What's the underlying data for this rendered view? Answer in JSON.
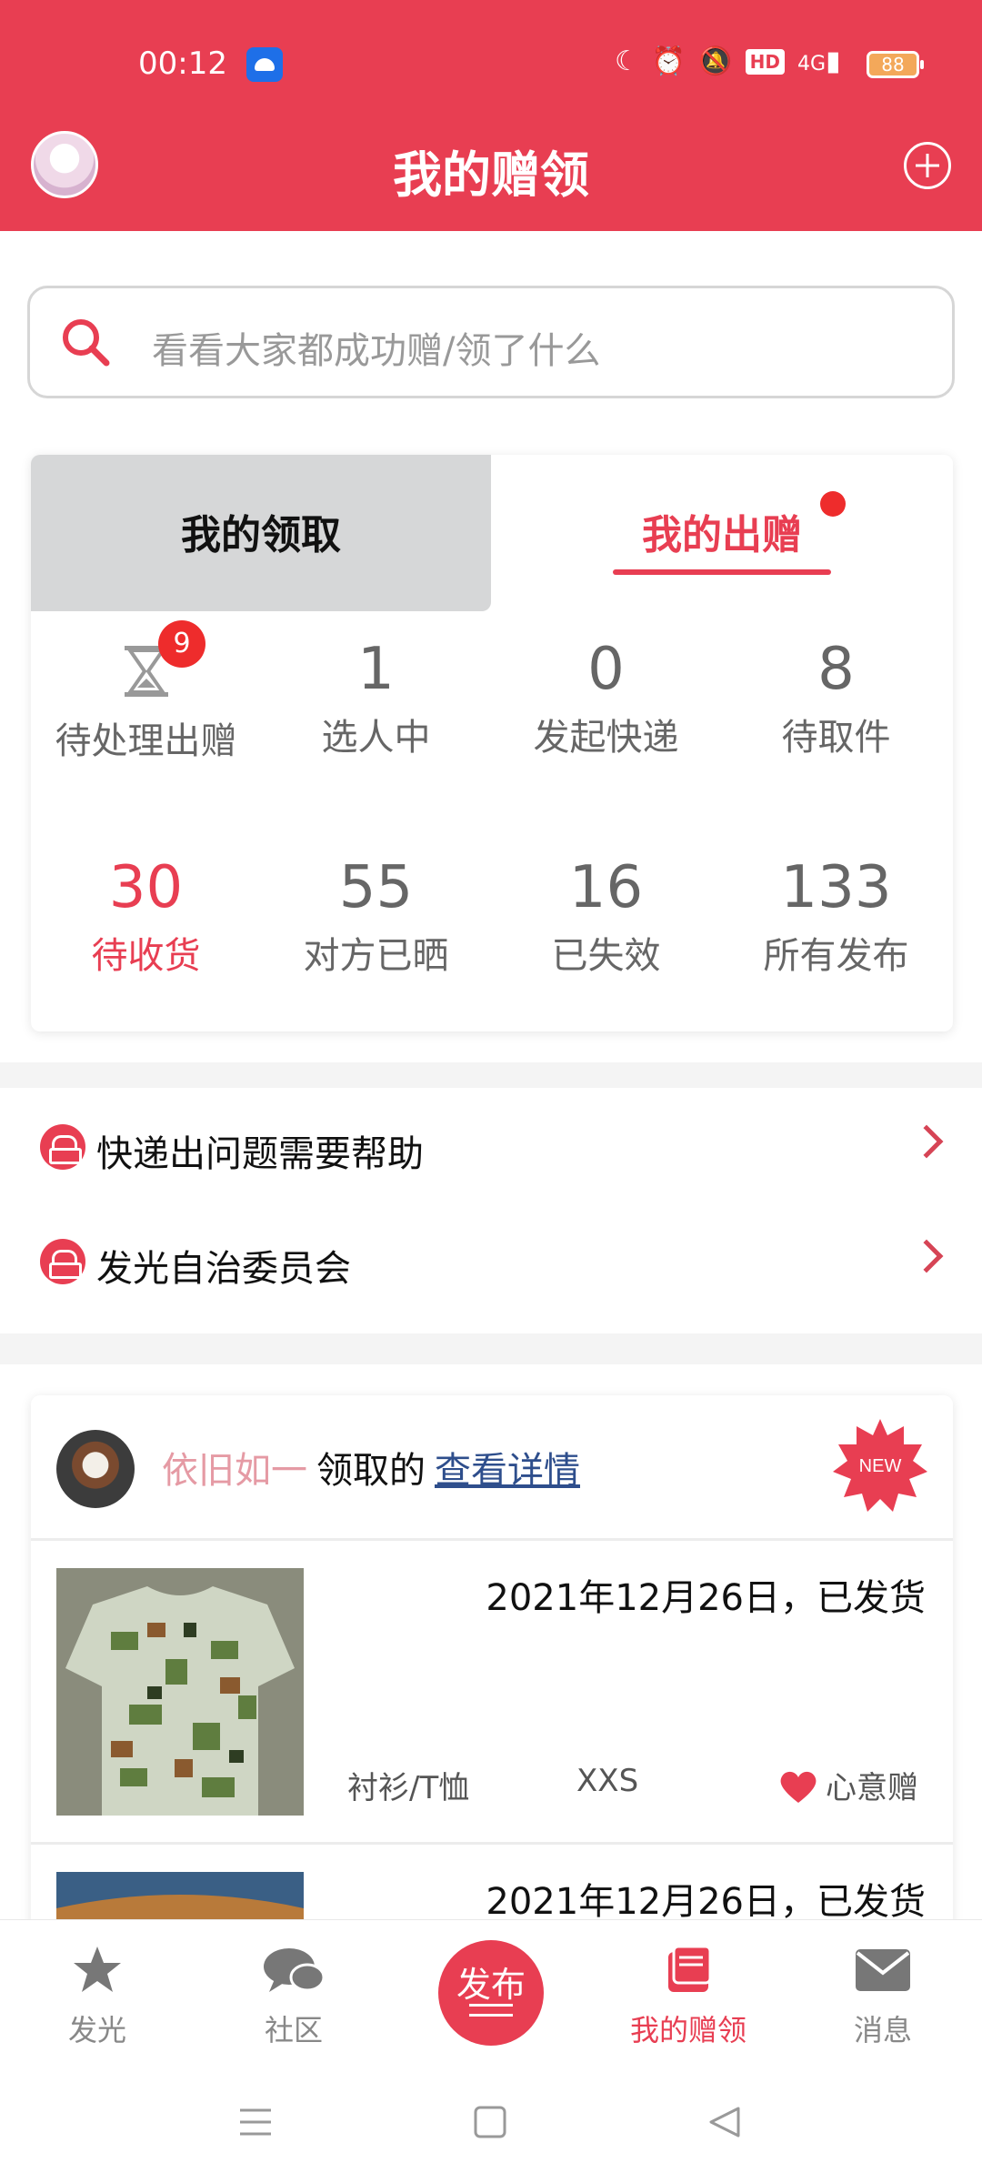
{
  "status_bar": {
    "time": "00:12",
    "icons": [
      "android-icon",
      "moon-icon",
      "alarm-icon",
      "mute-icon",
      "hd-icon",
      "signal-4g-icon"
    ],
    "hd": "HD",
    "network": "4G",
    "battery": "88"
  },
  "header": {
    "title": "我的赠领",
    "avatar_icon": "user-avatar",
    "add_icon": "plus-circle-icon"
  },
  "search": {
    "placeholder": "看看大家都成功赠/领了什么"
  },
  "tabs": {
    "left": "我的领取",
    "right": "我的出赠",
    "active": "right"
  },
  "stats_row1": [
    {
      "value": "",
      "label": "待处理出赠",
      "badge": "9",
      "icon": "hourglass-icon"
    },
    {
      "value": "1",
      "label": "选人中"
    },
    {
      "value": "0",
      "label": "发起快递"
    },
    {
      "value": "8",
      "label": "待取件"
    }
  ],
  "stats_row2": [
    {
      "value": "30",
      "label": "待收货",
      "highlight": true
    },
    {
      "value": "55",
      "label": "对方已晒"
    },
    {
      "value": "16",
      "label": "已失效"
    },
    {
      "value": "133",
      "label": "所有发布"
    }
  ],
  "menu": [
    {
      "label": "快递出问题需要帮助",
      "icon": "courier-icon"
    },
    {
      "label": "发光自治委员会",
      "icon": "courier-icon"
    }
  ],
  "feed": {
    "user": "依旧如一",
    "action": "领取的",
    "link": "查看详情",
    "badge": "NEW",
    "items": [
      {
        "date": "2021年12月26日，已发货",
        "category": "衬衫/T恤",
        "size": "XXS",
        "type": "心意赠"
      },
      {
        "date": "2021年12月26日，已发货",
        "category": "",
        "size": "",
        "type": ""
      }
    ]
  },
  "tabbar": {
    "items": [
      {
        "label": "发光",
        "icon": "star-icon"
      },
      {
        "label": "社区",
        "icon": "chat-bubbles-icon"
      },
      {
        "label": "发布",
        "icon": "publish-icon"
      },
      {
        "label": "我的赠领",
        "icon": "book-icon",
        "active": true
      },
      {
        "label": "消息",
        "icon": "mail-icon"
      }
    ]
  },
  "colors": {
    "brand": "#e83e52",
    "badge": "#ee2c2c",
    "link": "#2e4e8c"
  }
}
